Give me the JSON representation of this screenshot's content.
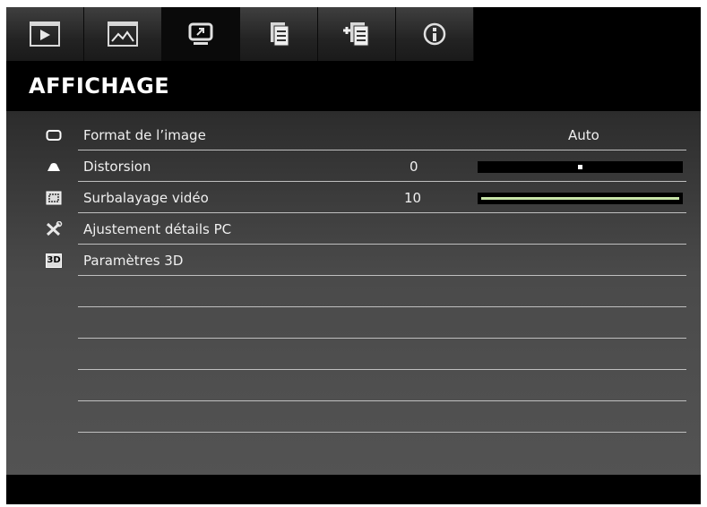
{
  "tabs": [
    {
      "name": "tab-image",
      "icon": "play-screen-icon"
    },
    {
      "name": "tab-picture",
      "icon": "picture-icon"
    },
    {
      "name": "tab-display",
      "icon": "display-icon",
      "active": true
    },
    {
      "name": "tab-settings",
      "icon": "document-icon"
    },
    {
      "name": "tab-settings-2",
      "icon": "document-plus-icon"
    },
    {
      "name": "tab-info",
      "icon": "info-icon"
    }
  ],
  "title": "AFFICHAGE",
  "menu": [
    {
      "label": "Format de l’image",
      "value": "Auto",
      "icon": "aspect-ratio-icon"
    },
    {
      "label": "Distorsion",
      "value": "0",
      "icon": "keystone-icon",
      "slider": 0.5
    },
    {
      "label": "Surbalayage vidéo",
      "value": "10",
      "icon": "overscan-icon",
      "slider": 1.0
    },
    {
      "label": "Ajustement détails PC",
      "icon": "tools-icon"
    },
    {
      "label": "Paramètres 3D",
      "icon": "3d-icon",
      "icon_text": "3D"
    }
  ],
  "colors": {
    "slider_fill": "#c8e5a8",
    "background": "#000000"
  }
}
